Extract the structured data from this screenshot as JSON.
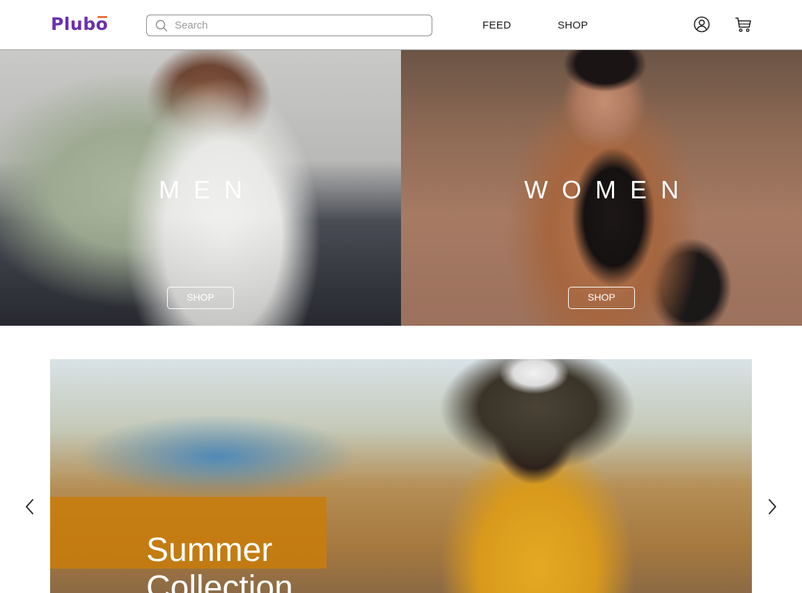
{
  "header": {
    "logo": "Plubo",
    "search": {
      "placeholder": "Search",
      "value": ""
    },
    "nav": [
      {
        "label": "FEED"
      },
      {
        "label": "SHOP"
      }
    ],
    "icons": {
      "user": "user-icon",
      "cart": "cart-icon",
      "search": "search-icon"
    }
  },
  "hero": {
    "men": {
      "title": "MEN",
      "button_label": "SHOP"
    },
    "women": {
      "title": "WOMEN",
      "button_label": "SHOP"
    }
  },
  "carousel": {
    "title": "Summer Collection",
    "prev_icon": "chevron-left-icon",
    "next_icon": "chevron-right-icon"
  },
  "colors": {
    "brand": "#6a2fb0",
    "logo_accent": "#e8713c",
    "promo_box": "#c87d0a"
  }
}
